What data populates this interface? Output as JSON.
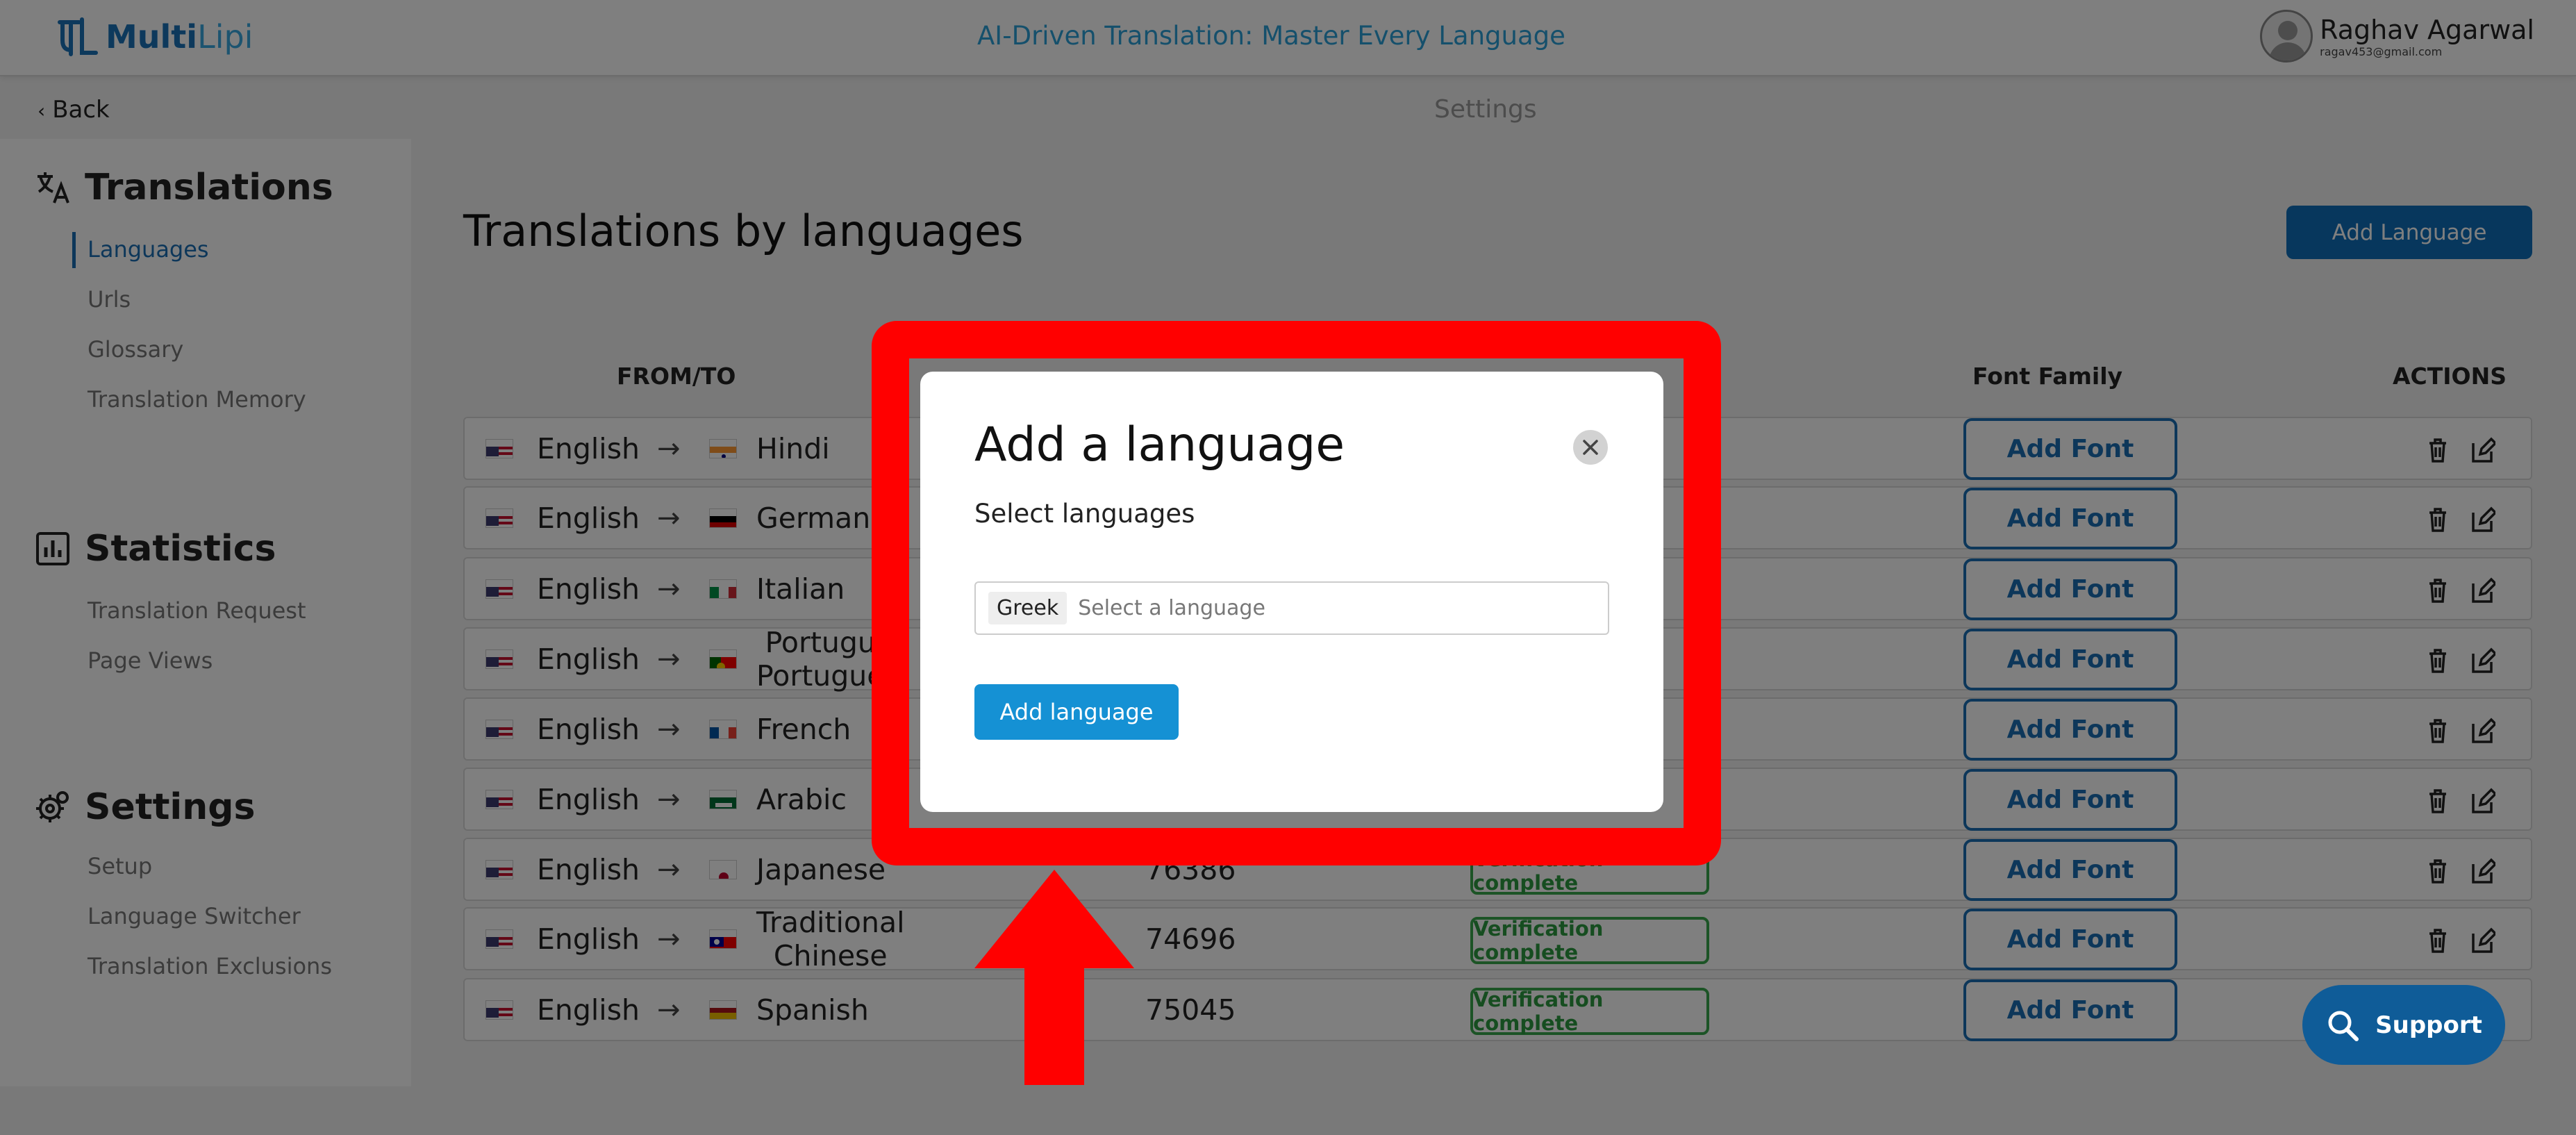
{
  "header": {
    "logo_left": "Multi",
    "logo_right": "Lipi",
    "tagline": "AI-Driven Translation: Master Every Language",
    "user_name": "Raghav Agarwal",
    "user_email": "ragav453@gmail.com"
  },
  "subheader": {
    "back_label": "Back",
    "page_name": "Settings"
  },
  "sidebar": {
    "translations_title": "Translations",
    "translations_items": [
      "Languages",
      "Urls",
      "Glossary",
      "Translation Memory"
    ],
    "statistics_title": "Statistics",
    "statistics_items": [
      "Translation Request",
      "Page Views"
    ],
    "settings_title": "Settings",
    "settings_items": [
      "Setup",
      "Language Switcher",
      "Translation Exclusions"
    ]
  },
  "main": {
    "title": "Translations by languages",
    "add_language_label": "Add Language",
    "columns": {
      "from_to": "FROM/TO",
      "font_family": "Font Family",
      "actions": "ACTIONS"
    },
    "rows": [
      {
        "from": "English",
        "to_line1": "Hindi",
        "to_line2": "",
        "words": "",
        "status": "",
        "font_btn": "Add Font"
      },
      {
        "from": "English",
        "to_line1": "German",
        "to_line2": "",
        "words": "",
        "status": "",
        "font_btn": "Add Font"
      },
      {
        "from": "English",
        "to_line1": "Italian",
        "to_line2": "",
        "words": "",
        "status": "",
        "font_btn": "Add Font"
      },
      {
        "from": "English",
        "to_line1": "Portugu",
        "to_line2": "Portugue",
        "words": "",
        "status": "",
        "font_btn": "Add Font"
      },
      {
        "from": "English",
        "to_line1": "French",
        "to_line2": "",
        "words": "",
        "status": "",
        "font_btn": "Add Font"
      },
      {
        "from": "English",
        "to_line1": "Arabic",
        "to_line2": "",
        "words": "",
        "status": "",
        "font_btn": "Add Font"
      },
      {
        "from": "English",
        "to_line1": "Japanese",
        "to_line2": "",
        "words": "76386",
        "status": "Verification complete",
        "font_btn": "Add Font"
      },
      {
        "from": "English",
        "to_line1": "Traditional",
        "to_line2": "Chinese",
        "words": "74696",
        "status": "Verification complete",
        "font_btn": "Add Font"
      },
      {
        "from": "English",
        "to_line1": "Spanish",
        "to_line2": "",
        "words": "75045",
        "status": "Verification complete",
        "font_btn": "Add Font"
      }
    ]
  },
  "modal": {
    "title": "Add a language",
    "subtitle": "Select languages",
    "selected_chip": "Greek",
    "select_placeholder": "Select a language",
    "add_button": "Add language"
  },
  "support": {
    "label": "Support"
  },
  "colors": {
    "brand": "#1b6fb5",
    "accent": "#1591d4",
    "success": "#39a84c",
    "highlight": "#ff0000"
  }
}
